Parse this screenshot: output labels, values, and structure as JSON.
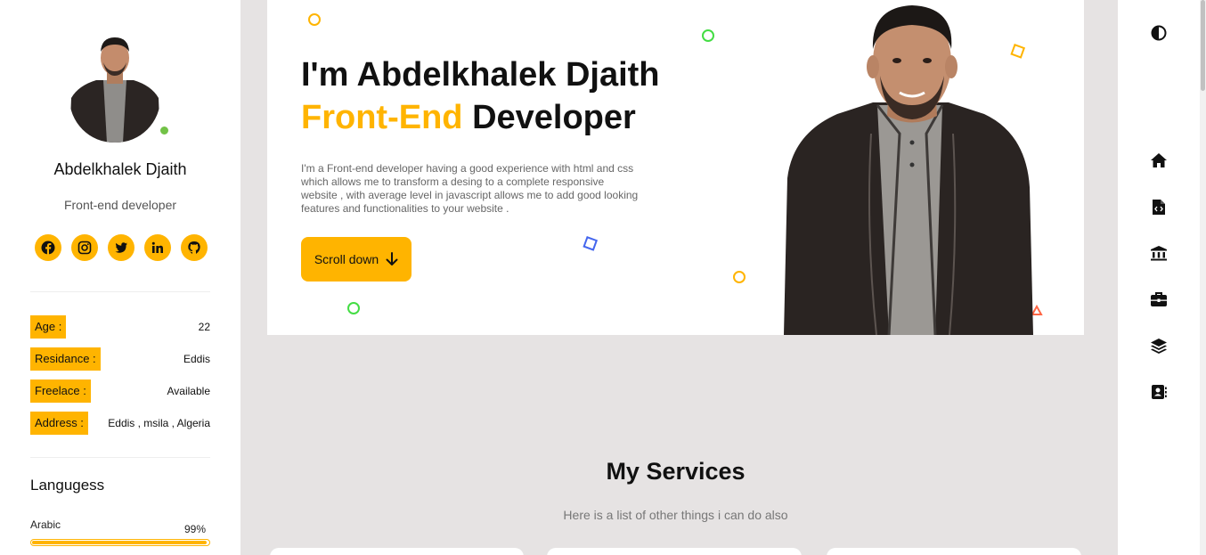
{
  "profile": {
    "name": "Abdelkhalek Djaith",
    "role": "Front-end developer",
    "status_color": "#72c247",
    "socials": [
      {
        "icon": "facebook-icon"
      },
      {
        "icon": "instagram-icon"
      },
      {
        "icon": "twitter-icon"
      },
      {
        "icon": "linkedin-icon"
      },
      {
        "icon": "github-icon"
      }
    ]
  },
  "info": [
    {
      "label": "Age :",
      "value": "22"
    },
    {
      "label": "Residance :",
      "value": "Eddis"
    },
    {
      "label": "Freelace :",
      "value": "Available"
    },
    {
      "label": "Address :",
      "value": "Eddis , msila , Algeria"
    }
  ],
  "languages": {
    "title": "Langugess",
    "items": [
      {
        "name": "Arabic",
        "percent_label": "99%",
        "level": 0.99
      }
    ]
  },
  "hero": {
    "line1": "I'm Abdelkhalek Djaith",
    "accent_word": "Front-End",
    "line2_rest": " Developer",
    "description": "I'm a Front-end developer having a good experience with html and css which allows me to transform a desing to a complete responsive website , with average level in javascript allows me to add good looking features and functionalities to your website .",
    "cta_label": "Scroll down"
  },
  "services": {
    "title": "My Services",
    "subtitle": "Here is a list of other things i can do also"
  },
  "nav": [
    {
      "icon": "theme-toggle-icon"
    },
    {
      "icon": "home-icon"
    },
    {
      "icon": "code-file-icon"
    },
    {
      "icon": "bank-icon"
    },
    {
      "icon": "briefcase-icon"
    },
    {
      "icon": "layers-icon"
    },
    {
      "icon": "contact-book-icon"
    }
  ],
  "colors": {
    "accent": "#ffb400",
    "background": "#e6e3e3"
  }
}
